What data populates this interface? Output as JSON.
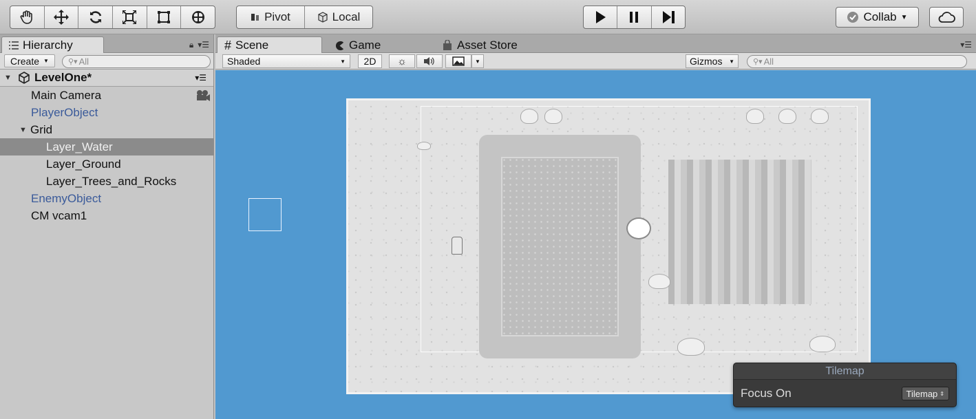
{
  "toolbar": {
    "tools": [
      "hand-tool",
      "move-tool",
      "rotate-tool",
      "scale-tool",
      "rect-tool",
      "transform-tool"
    ],
    "pivot_label": "Pivot",
    "local_label": "Local",
    "collab_label": "Collab"
  },
  "hierarchy": {
    "tab_label": "Hierarchy",
    "create_label": "Create",
    "search_placeholder": "All",
    "scene_name": "LevelOne*",
    "items": [
      {
        "label": "Main Camera"
      },
      {
        "label": "PlayerObject"
      },
      {
        "label": "Grid"
      },
      {
        "label": "Layer_Water"
      },
      {
        "label": "Layer_Ground"
      },
      {
        "label": "Layer_Trees_and_Rocks"
      },
      {
        "label": "EnemyObject"
      },
      {
        "label": "CM vcam1"
      }
    ]
  },
  "scene": {
    "tabs": [
      {
        "label": "Scene"
      },
      {
        "label": "Game"
      },
      {
        "label": "Asset Store"
      }
    ],
    "shading_mode": "Shaded",
    "mode_2d_label": "2D",
    "gizmos_label": "Gizmos",
    "search_placeholder": "All"
  },
  "tilemap_overlay": {
    "title": "Tilemap",
    "focus_label": "Focus On",
    "focus_value": "Tilemap"
  },
  "colors": {
    "viewport_bg": "#5199d0",
    "selected_row": "#8b8b8b",
    "prefab_text": "#3a5a9a"
  }
}
